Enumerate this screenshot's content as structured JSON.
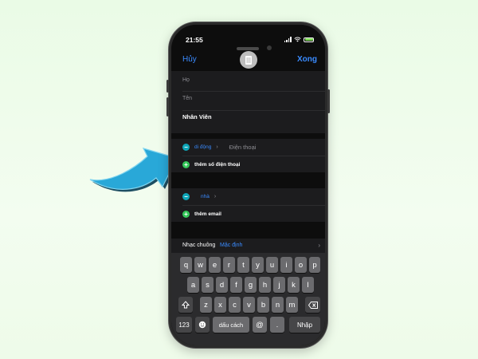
{
  "status_bar": {
    "time": "21:55"
  },
  "nav": {
    "cancel": "Hủy",
    "done": "Xong"
  },
  "name_fields": [
    {
      "label": "Họ",
      "filled": false
    },
    {
      "label": "Tên",
      "filled": false
    },
    {
      "label": "Nhân Viên",
      "filled": true
    }
  ],
  "phone_section": {
    "type_label": "di động",
    "input_placeholder": "Điện thoại",
    "add_label": "thêm số điện thoại"
  },
  "email_section": {
    "type_label": "nhà",
    "add_label": "thêm email"
  },
  "ringtone": {
    "label": "Nhạc chuông",
    "value": "Mặc định"
  },
  "keyboard": {
    "row1": [
      "q",
      "w",
      "e",
      "r",
      "t",
      "y",
      "u",
      "i",
      "o",
      "p"
    ],
    "row2": [
      "a",
      "s",
      "d",
      "f",
      "g",
      "h",
      "j",
      "k",
      "l"
    ],
    "row3": [
      "z",
      "x",
      "c",
      "v",
      "b",
      "n",
      "m"
    ],
    "numbers": "123",
    "space": "dấu cách",
    "at": "@",
    "dot": ".",
    "return": "Nhập"
  },
  "colors": {
    "accent": "#3a8bff",
    "remove": "#0ea5b7",
    "add": "#34c759",
    "arrow": "#29a8d8",
    "background": "#eafbe6"
  }
}
